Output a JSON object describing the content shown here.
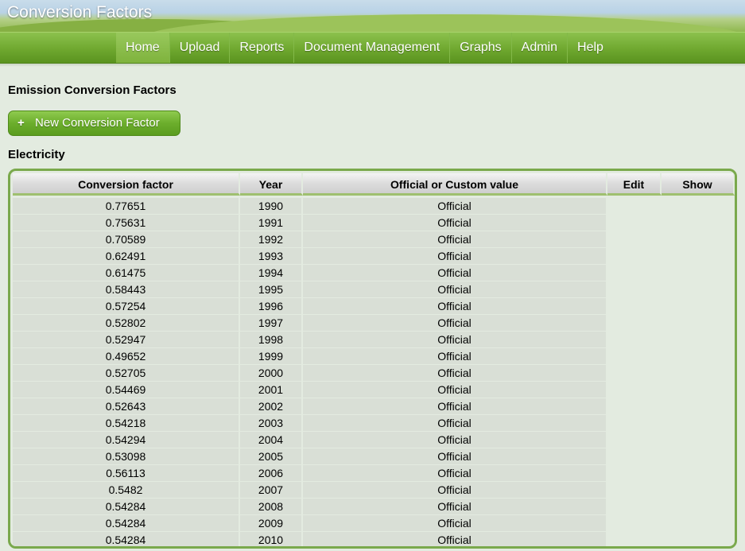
{
  "app": {
    "title": "Conversion Factors"
  },
  "nav": [
    {
      "label": "Home",
      "active": true
    },
    {
      "label": "Upload"
    },
    {
      "label": "Reports"
    },
    {
      "label": "Document Management"
    },
    {
      "label": "Graphs"
    },
    {
      "label": "Admin"
    },
    {
      "label": "Help"
    }
  ],
  "page": {
    "heading": "Emission Conversion Factors",
    "new_button": {
      "icon": "plus-icon",
      "label": "New Conversion Factor"
    },
    "section": "Electricity"
  },
  "table": {
    "columns": [
      "Conversion factor",
      "Year",
      "Official or Custom value",
      "Edit",
      "Show"
    ],
    "rows": [
      [
        "0.77651",
        "1990",
        "Official"
      ],
      [
        "0.75631",
        "1991",
        "Official"
      ],
      [
        "0.70589",
        "1992",
        "Official"
      ],
      [
        "0.62491",
        "1993",
        "Official"
      ],
      [
        "0.61475",
        "1994",
        "Official"
      ],
      [
        "0.58443",
        "1995",
        "Official"
      ],
      [
        "0.57254",
        "1996",
        "Official"
      ],
      [
        "0.52802",
        "1997",
        "Official"
      ],
      [
        "0.52947",
        "1998",
        "Official"
      ],
      [
        "0.49652",
        "1999",
        "Official"
      ],
      [
        "0.52705",
        "2000",
        "Official"
      ],
      [
        "0.54469",
        "2001",
        "Official"
      ],
      [
        "0.52643",
        "2002",
        "Official"
      ],
      [
        "0.54218",
        "2003",
        "Official"
      ],
      [
        "0.54294",
        "2004",
        "Official"
      ],
      [
        "0.53098",
        "2005",
        "Official"
      ],
      [
        "0.56113",
        "2006",
        "Official"
      ],
      [
        "0.5482",
        "2007",
        "Official"
      ],
      [
        "0.54284",
        "2008",
        "Official"
      ],
      [
        "0.54284",
        "2009",
        "Official"
      ],
      [
        "0.54284",
        "2010",
        "Official"
      ]
    ]
  },
  "colors": {
    "nav_green": "#6fa82f",
    "frame_green": "#7aa94c",
    "page_bg": "#e3ebe0"
  }
}
